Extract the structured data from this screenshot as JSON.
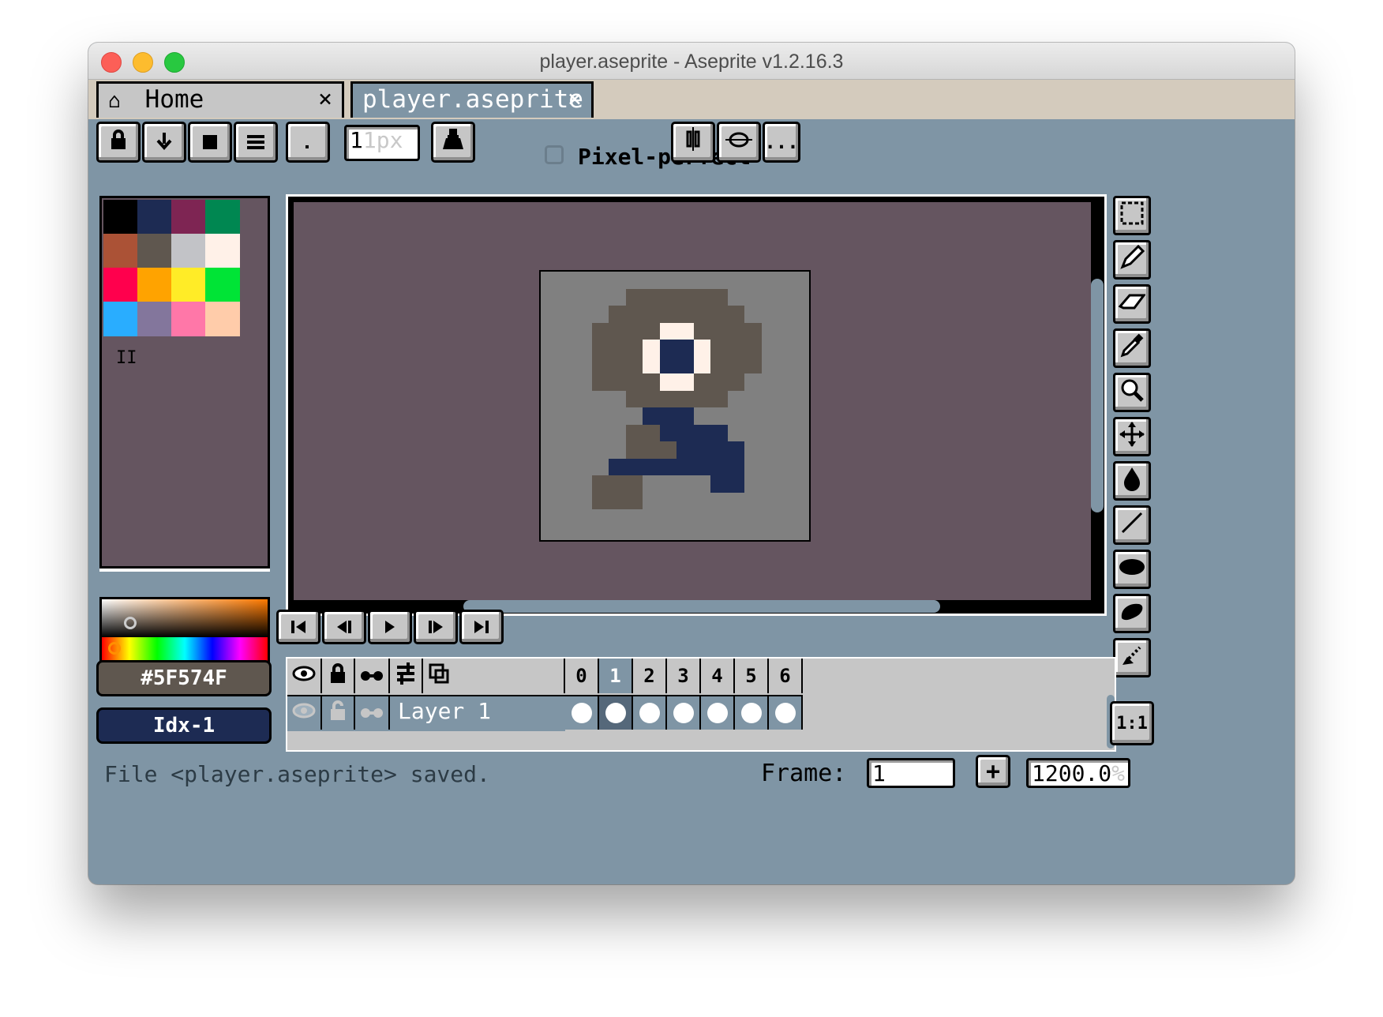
{
  "window": {
    "title": "player.aseprite - Aseprite v1.2.16.3"
  },
  "tabs": [
    {
      "label": "Home",
      "close": "×",
      "icon": "home-icon"
    },
    {
      "label": "player.aseprite",
      "close": "×"
    }
  ],
  "toolbar": {
    "lock_icon": "lock-icon",
    "brush_size_placeholder": "1px",
    "pixel_perfect_label": "Pixel-perfect",
    "more_label": "..."
  },
  "palette": {
    "colors": [
      "#000000",
      "#1d2b53",
      "#7e2553",
      "#008751",
      "#ab5236",
      "#5f574f",
      "#c2c3c7",
      "#fff1e8",
      "#ff004d",
      "#ffa300",
      "#ffec27",
      "#00e436",
      "#29adff",
      "#83769c",
      "#ff77a8",
      "#ffccaa"
    ],
    "handle": "II"
  },
  "colors": {
    "foreground_hex": "#5F574F",
    "background_index": "Idx-1",
    "background_swatch": "#1d2b53"
  },
  "sprite": {
    "background": "#808080",
    "colors": {
      "body": "#5f574f",
      "eye_white": "#fff1e8",
      "eye_pupil": "#1d2b53",
      "legs": "#1d2b53"
    }
  },
  "playback": [
    "first-frame-icon",
    "previous-frame-icon",
    "play-icon",
    "next-frame-icon",
    "last-frame-icon"
  ],
  "timeline": {
    "frames": [
      "0",
      "1",
      "2",
      "3",
      "4",
      "5",
      "6"
    ],
    "active_frame_index": 1,
    "layer_name": "Layer 1"
  },
  "tools": [
    "marquee-icon",
    "pencil-icon",
    "eraser-icon",
    "eyedropper-icon",
    "zoom-icon",
    "move-icon",
    "fill-icon",
    "line-icon",
    "ellipse-icon",
    "contour-icon",
    "blur-icon"
  ],
  "zoom_reset_label": "1:1",
  "status": {
    "message": "File <player.aseprite> saved.",
    "frame_label": "Frame:",
    "frame_value": "1",
    "add_label": "+",
    "zoom_value": "1200.0",
    "zoom_unit": "%"
  }
}
